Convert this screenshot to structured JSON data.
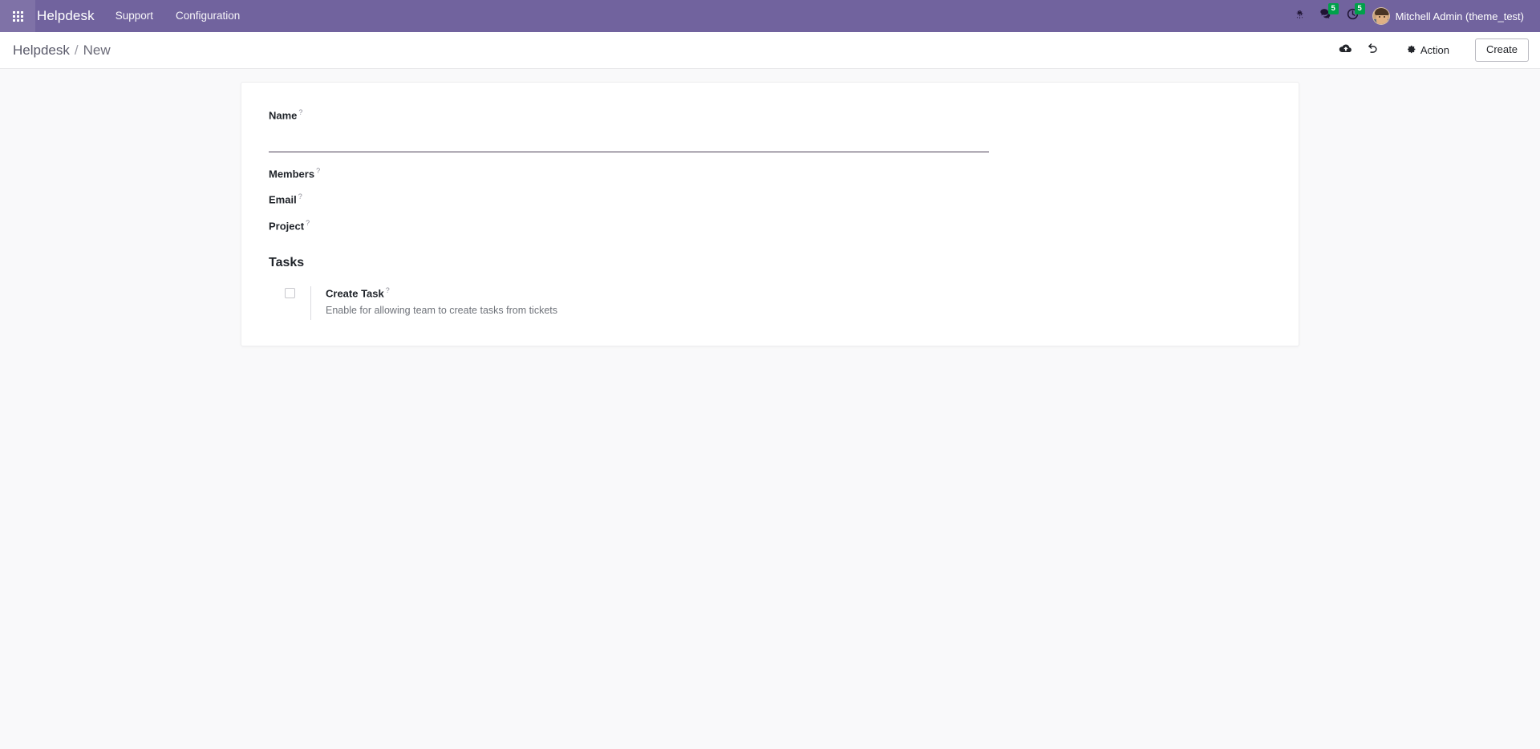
{
  "navbar": {
    "apps_icon": "apps-grid-icon",
    "brand": "Helpdesk",
    "menus": [
      {
        "label": "Support"
      },
      {
        "label": "Configuration"
      }
    ],
    "systray": {
      "debug_icon": "bug-icon",
      "messages_icon": "messages-icon",
      "messages_count": "5",
      "activities_icon": "clock-icon",
      "activities_count": "5",
      "badge_color": "#00a04a"
    },
    "user": {
      "avatar": "user-avatar",
      "name": "Mitchell Admin (theme_test)"
    },
    "background_color": "#71639e"
  },
  "control_panel": {
    "breadcrumb": {
      "root": "Helpdesk",
      "separator": "/",
      "current": "New"
    },
    "save_icon": "cloud-upload-icon",
    "discard_icon": "undo-icon",
    "action_gear_icon": "gear-icon",
    "action_label": "Action",
    "create_label": "Create"
  },
  "form": {
    "help_marker": "?",
    "fields": [
      {
        "label": "Name",
        "value": "",
        "placeholder": ""
      },
      {
        "label": "Members",
        "value": ""
      },
      {
        "label": "Email",
        "value": ""
      },
      {
        "label": "Project",
        "value": ""
      }
    ],
    "sections": [
      {
        "title": "Tasks",
        "settings": [
          {
            "label": "Create Task",
            "description": "Enable for allowing team to create tasks from tickets",
            "checked": false
          }
        ]
      }
    ]
  }
}
